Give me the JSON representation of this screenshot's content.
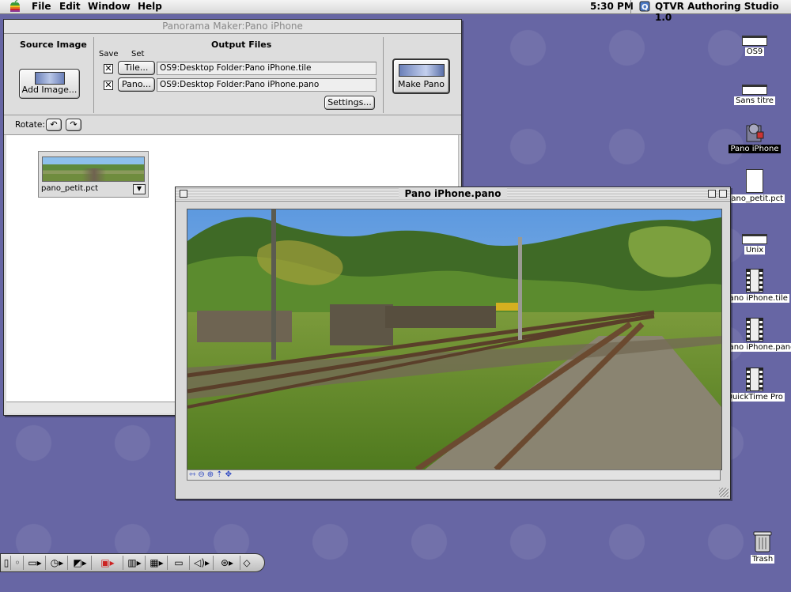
{
  "menubar": {
    "apple_icon": "apple-icon",
    "items": [
      "File",
      "Edit",
      "Window",
      "Help"
    ],
    "clock": "5:30 PM",
    "app_name": "QTVR Authoring Studio 1.0"
  },
  "panorama_window": {
    "title": "Panorama Maker:Pano iPhone",
    "source_image": {
      "heading": "Source Image",
      "add_button": "Add Image..."
    },
    "output_files": {
      "heading": "Output Files",
      "col_save": "Save",
      "col_set": "Set",
      "tile_button": "Tile...",
      "tile_path": "OS9:Desktop Folder:Pano iPhone.tile",
      "pano_button": "Pano...",
      "pano_path": "OS9:Desktop Folder:Pano iPhone.pano",
      "settings_button": "Settings...",
      "tile_checked": true,
      "pano_checked": true,
      "check_mark": "✕"
    },
    "make_pano_button": "Make Pano",
    "rotate_label": "Rotate:",
    "source_file": {
      "name": "pano_petit.pct"
    }
  },
  "pano_window": {
    "title": "Pano iPhone.pano",
    "controls": [
      "pan-icon",
      "zoom-out-icon",
      "zoom-in-icon",
      "hotspot-icon",
      "move-icon"
    ]
  },
  "desktop_icons": [
    {
      "label": "OS9",
      "kind": "disk",
      "selected": false
    },
    {
      "label": "Sans titre",
      "kind": "disk",
      "selected": false
    },
    {
      "label": "Pano iPhone",
      "kind": "app",
      "selected": true
    },
    {
      "label": "pano_petit.pct",
      "kind": "document",
      "selected": false
    },
    {
      "label": "Unix",
      "kind": "disk",
      "selected": false
    },
    {
      "label": "Pano iPhone.tile",
      "kind": "movie",
      "selected": false
    },
    {
      "label": "Pano iPhone.pano",
      "kind": "movie",
      "selected": false
    },
    {
      "label": "QuickTime Pro",
      "kind": "movie",
      "selected": false
    },
    {
      "label": "Trash",
      "kind": "trash",
      "selected": false
    }
  ],
  "colors": {
    "desktop": "#6766a4",
    "window_bg": "#dddddd",
    "sky": "#8fbde8"
  }
}
